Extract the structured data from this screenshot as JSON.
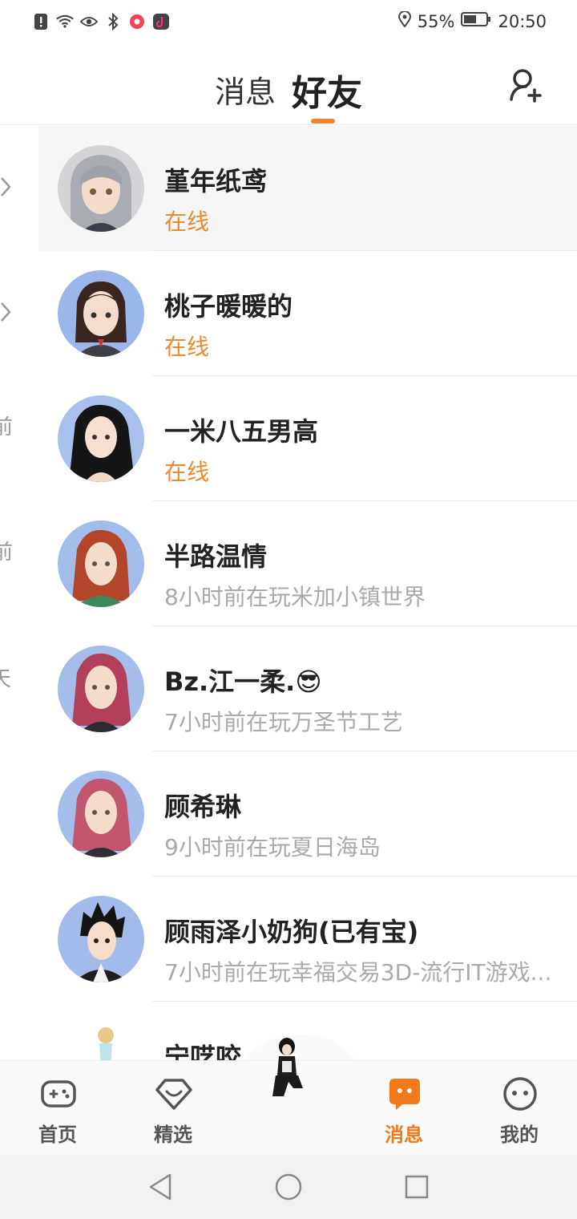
{
  "status_bar": {
    "battery": "55%",
    "time": "20:50"
  },
  "header": {
    "tab_messages": "消息",
    "tab_friends": "好友"
  },
  "peek": [
    "前",
    "前",
    "天"
  ],
  "friends": [
    {
      "name": "堇年纸鸢",
      "status": "在线",
      "online": true
    },
    {
      "name": "桃子暖暖的",
      "status": "在线",
      "online": true
    },
    {
      "name": "一米八五男高",
      "status": "在线",
      "online": true
    },
    {
      "name": "半路温情",
      "status": "8小时前在玩米加小镇世界",
      "online": false
    },
    {
      "name": "Bz.江一柔.😎",
      "status": "7小时前在玩万圣节工艺",
      "online": false
    },
    {
      "name": "顾希琳",
      "status": "9小时前在玩夏日海岛",
      "online": false
    },
    {
      "name": "顾雨泽小奶狗(已有宝)",
      "status": "7小时前在玩幸福交易3D-流行IT游戏...",
      "online": false
    },
    {
      "name": "宁呓咬",
      "status": "",
      "online": false
    }
  ],
  "bottom_nav": {
    "home": "首页",
    "featured": "精选",
    "messages": "消息",
    "mine": "我的"
  },
  "colors": {
    "accent": "#f07a1a",
    "online": "#e98a2e"
  }
}
